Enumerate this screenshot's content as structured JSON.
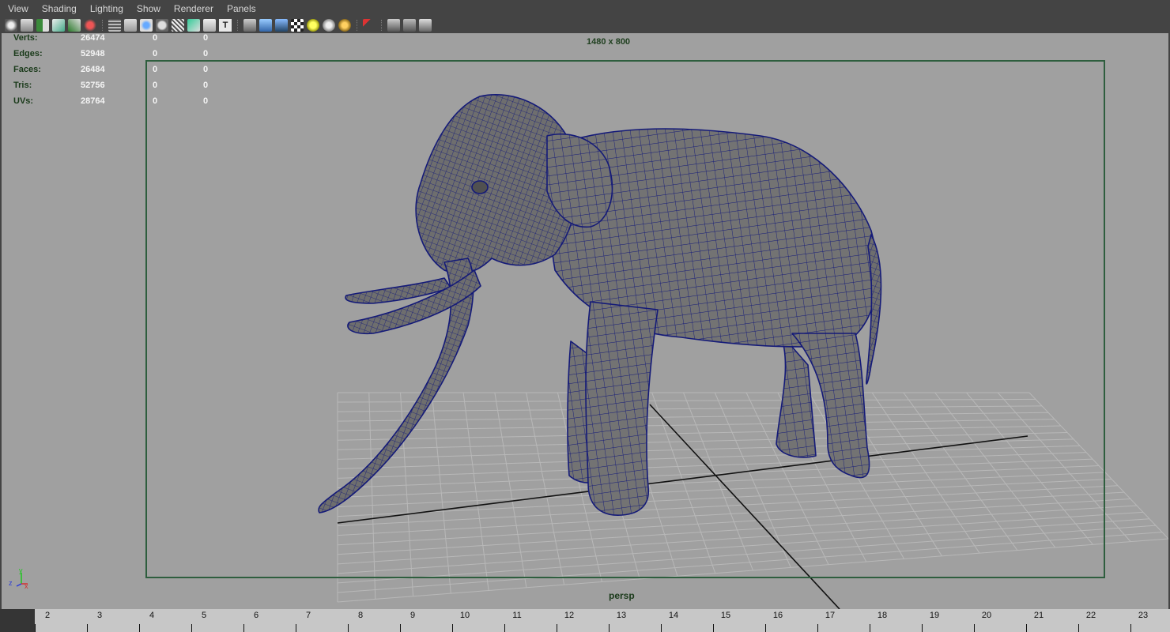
{
  "menu": [
    "View",
    "Shading",
    "Lighting",
    "Show",
    "Renderer",
    "Panels"
  ],
  "toolbar": {
    "icons": [
      "select-camera-icon",
      "camera-attributes-icon",
      "bookmarks-icon",
      "image-plane-icon",
      "grease-pencil-icon",
      "unlock-camera-icon",
      "grid-icon",
      "film-gate-icon",
      "resolution-gate-icon",
      "gate-mask-icon",
      "field-chart-icon",
      "safe-action-icon",
      "safe-title-icon",
      "wireframe-icon",
      "smooth-shade-icon",
      "wireframe-on-shaded-icon",
      "textured-icon",
      "use-all-lights-icon",
      "shadows-icon",
      "ambient-occlusion-icon",
      "isolate-select-icon",
      "xray-icon",
      "xray-joints-icon",
      "xray-components-icon"
    ],
    "text_icon_label": "T"
  },
  "hud": {
    "rows": [
      {
        "label": "Verts:",
        "total": "26474",
        "selected": "0",
        "component": "0"
      },
      {
        "label": "Edges:",
        "total": "52948",
        "selected": "0",
        "component": "0"
      },
      {
        "label": "Faces:",
        "total": "26484",
        "selected": "0",
        "component": "0"
      },
      {
        "label": "Tris:",
        "total": "52756",
        "selected": "0",
        "component": "0"
      },
      {
        "label": "UVs:",
        "total": "28764",
        "selected": "0",
        "component": "0"
      }
    ]
  },
  "viewport": {
    "resolution_label": "1480 x 800",
    "camera_label": "persp",
    "gizmo": {
      "y": "y",
      "z": "z",
      "x": "x"
    },
    "colors": {
      "background": "#a0a0a0",
      "gate": "#2e5e3e",
      "mesh_fill": "#737373",
      "wire": "#141a78"
    }
  },
  "timeline": {
    "frames": [
      "2",
      "3",
      "4",
      "5",
      "6",
      "7",
      "8",
      "9",
      "10",
      "11",
      "12",
      "13",
      "14",
      "15",
      "16",
      "17",
      "18",
      "19",
      "20",
      "21",
      "22",
      "23"
    ]
  }
}
